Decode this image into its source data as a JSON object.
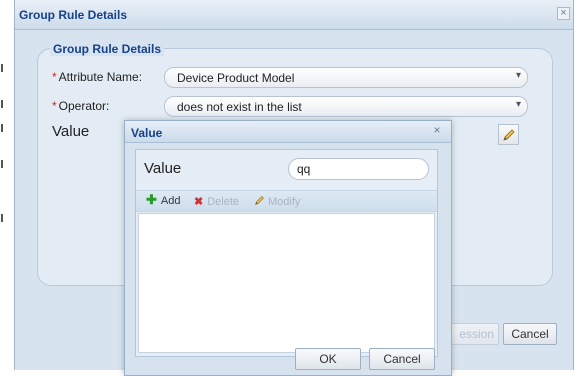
{
  "outer_dialog": {
    "title": "Group Rule Details",
    "close_glyph": "×",
    "fieldset_legend": "Group Rule Details",
    "attribute_label": "Attribute Name:",
    "attribute_value": "Device Product Model",
    "operator_label": "Operator:",
    "operator_value": "does not exist in the list",
    "required_mark": "*",
    "value_label": "Value",
    "dropdown_glyph": "▾",
    "footer": {
      "hidden_button_fragment": "ession",
      "cancel_label": "Cancel"
    }
  },
  "value_modal": {
    "title": "Value",
    "close_glyph": "×",
    "value_label": "Value",
    "value_input": "qq",
    "toolbar": {
      "add": {
        "icon": "plus-icon",
        "glyph": "✚",
        "label": "Add"
      },
      "delete": {
        "icon": "delete-icon",
        "glyph": "✖",
        "label": "Delete"
      },
      "modify": {
        "icon": "pencil-icon",
        "label": "Modify"
      }
    },
    "items": [],
    "ok_label": "OK",
    "cancel_label": "Cancel"
  },
  "colors": {
    "title_text": "#15428b",
    "panel_bg": "#d7e3ef",
    "required": "#dd2222",
    "add_icon": "#2a9a2a",
    "delete_icon": "#cc3333"
  }
}
